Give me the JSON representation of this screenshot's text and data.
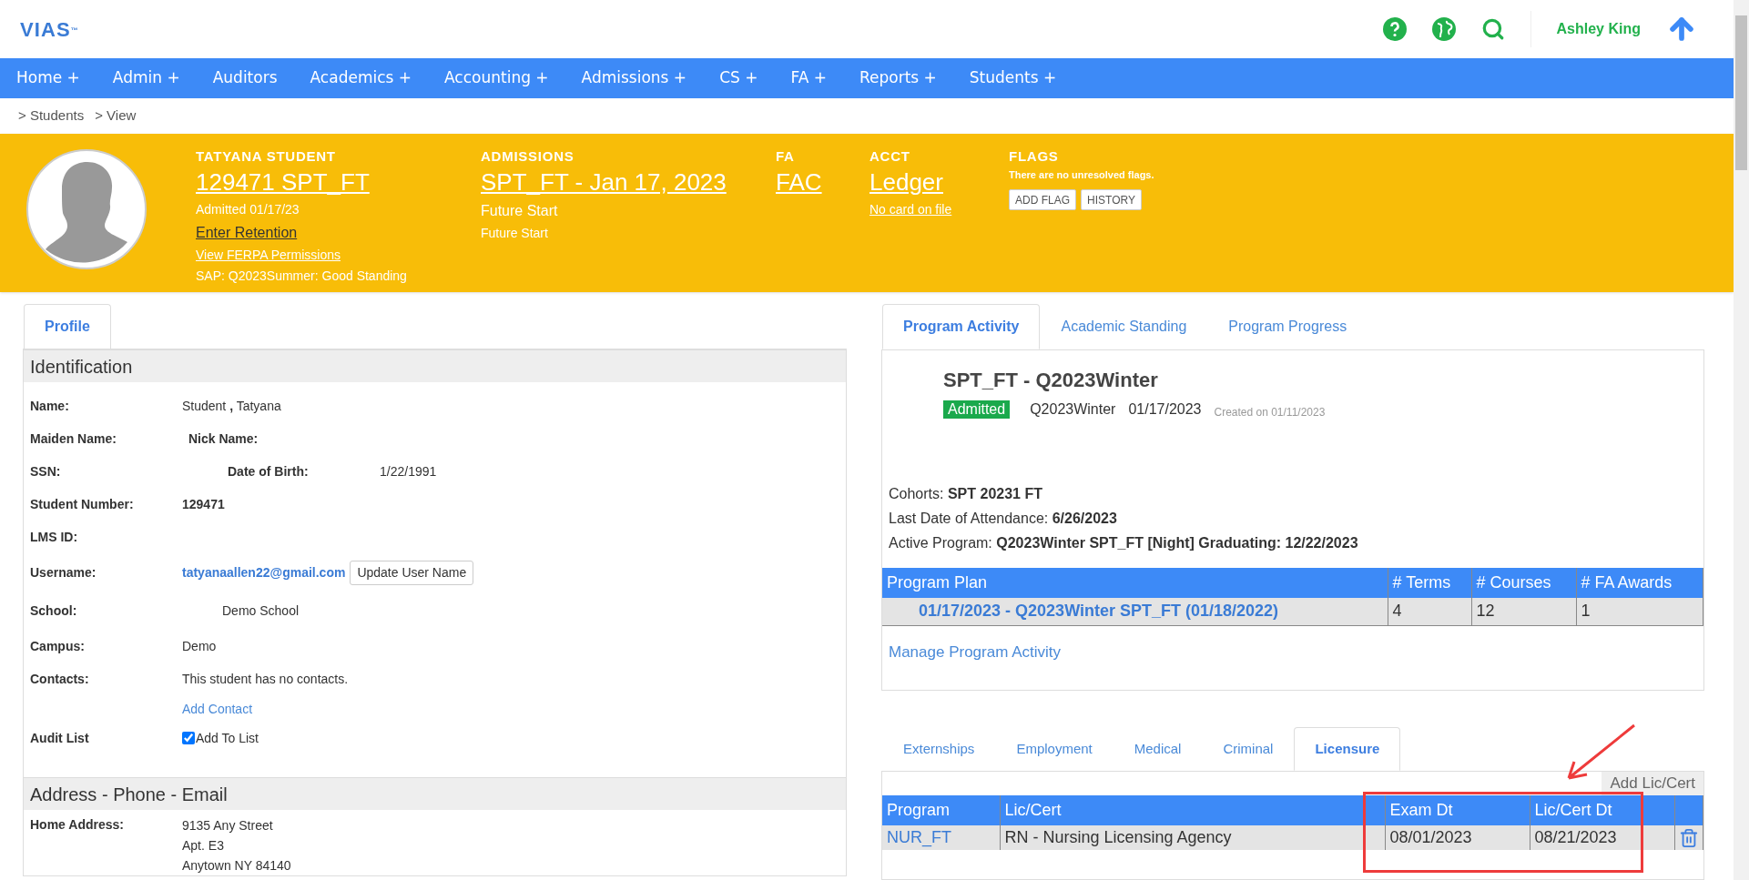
{
  "header": {
    "logo": "VIAS",
    "logo_mark": "™",
    "user_name": "Ashley King"
  },
  "nav": [
    "Home +",
    "Admin +",
    "Auditors",
    "Academics +",
    "Accounting +",
    "Admissions +",
    "CS +",
    "FA +",
    "Reports +",
    "Students +"
  ],
  "breadcrumb": [
    "> Students",
    "> View"
  ],
  "banner": {
    "student": {
      "heading": "TATYANA STUDENT",
      "link": "129471 SPT_FT",
      "admitted": "Admitted 01/17/23",
      "retention_link": "Enter Retention",
      "ferpa_link": "View FERPA Permissions",
      "sap": "SAP: Q2023Summer: Good Standing"
    },
    "admissions": {
      "heading": "ADMISSIONS",
      "link": "SPT_FT - Jan 17, 2023",
      "status": "Future Start",
      "substatus": "Future Start"
    },
    "fa": {
      "heading": "FA",
      "link": "FAC"
    },
    "acct": {
      "heading": "ACCT",
      "link": "Ledger",
      "card_link": "No card on file"
    },
    "flags": {
      "heading": "FLAGS",
      "message": "There are no unresolved flags.",
      "buttons": [
        "ADD FLAG",
        "HISTORY"
      ]
    }
  },
  "profile": {
    "tabs": [
      {
        "label": "Profile",
        "selected": true
      }
    ],
    "identification": {
      "title": "Identification",
      "name": {
        "label": "Name:",
        "value": "Student **,** Tatyana"
      },
      "maiden": {
        "label": "Maiden Name:"
      },
      "nick": {
        "label": "Nick Name:"
      },
      "ssn": {
        "label": "SSN:"
      },
      "dob": {
        "label": "Date of Birth:",
        "value": "1/22/1991"
      },
      "student_number": {
        "label": "Student Number:",
        "value": "129471"
      },
      "lms": {
        "label": "LMS ID:"
      },
      "username": {
        "label": "Username:",
        "value": "tatyanaallen22@gmail.com",
        "button": "Update User Name"
      },
      "school": {
        "label": "School:",
        "value": "Demo School"
      },
      "campus": {
        "label": "Campus:",
        "value": "Demo"
      },
      "contacts": {
        "label": "Contacts:",
        "value": "This student has no contacts.",
        "link": "Add Contact"
      },
      "audit": {
        "label": "Audit List",
        "checkbox_label": "Add To List",
        "checked": true
      }
    },
    "address": {
      "title": "Address - Phone - Email",
      "home_label": "Home Address:",
      "home_lines": [
        "9135 Any Street",
        "Apt. E3",
        "Anytown NY 84140"
      ]
    }
  },
  "program": {
    "tabs": [
      {
        "label": "Program Activity",
        "selected": true
      },
      {
        "label": "Academic Standing",
        "selected": false
      },
      {
        "label": "Program Progress",
        "selected": false
      }
    ],
    "title": "SPT_FT - Q2023Winter",
    "badge": "Admitted",
    "term": "Q2023Winter",
    "date": "01/17/2023",
    "created": "Created on 01/11/2023",
    "details": [
      {
        "label": "Cohorts: ",
        "value": "SPT 20231 FT"
      },
      {
        "label": "Last Date of Attendance: ",
        "value": "6/26/2023"
      },
      {
        "label": "Active Program: ",
        "value": "Q2023Winter SPT_FT [Night] Graduating: 12/22/2023"
      }
    ],
    "plan_table": {
      "columns": [
        "Program Plan",
        "# Terms",
        "# Courses",
        "# FA Awards"
      ],
      "rows": [
        [
          "01/17/2023 - Q2023Winter SPT_FT (01/18/2022)",
          "4",
          "12",
          "1"
        ]
      ]
    },
    "manage_link": "Manage Program Activity"
  },
  "records": {
    "tabs": [
      {
        "label": "Externships",
        "selected": false
      },
      {
        "label": "Employment",
        "selected": false
      },
      {
        "label": "Medical",
        "selected": false
      },
      {
        "label": "Criminal",
        "selected": false
      },
      {
        "label": "Licensure",
        "selected": true
      }
    ],
    "add_link": "Add Lic/Cert",
    "table": {
      "columns": [
        "Program",
        "Lic/Cert",
        "Exam Dt",
        "Lic/Cert Dt"
      ],
      "rows": [
        [
          "NUR_FT",
          "RN - Nursing Licensing Agency",
          "08/01/2023",
          "08/21/2023"
        ]
      ]
    }
  }
}
